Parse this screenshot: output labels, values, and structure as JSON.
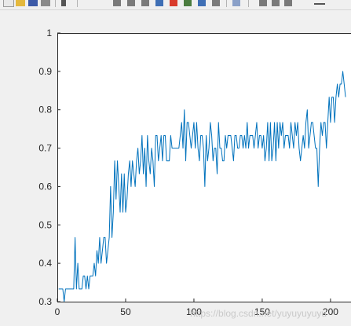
{
  "toolbar": {
    "icons": [
      "new-figure-icon",
      "open-file-icon",
      "save-icon",
      "print-icon",
      "edit-plot-icon",
      "zoom-in-icon",
      "zoom-out-icon",
      "pan-icon",
      "rotate-icon",
      "data-cursor-icon",
      "brush-icon",
      "insert-legend-icon",
      "link-plot-icon",
      "dock-icon"
    ]
  },
  "watermark": "https://blog.csdn.net/yuyuyuyuyu",
  "colors": {
    "figure_bg": "#f0f0f0",
    "axes_bg": "#ffffff",
    "line": "#0072bd",
    "axis": "#262626"
  },
  "chart_data": {
    "type": "line",
    "title": "",
    "xlabel": "",
    "ylabel": "",
    "xlim": [
      0,
      215
    ],
    "ylim": [
      0.3,
      1.0
    ],
    "xticks": [
      0,
      50,
      100,
      150,
      200
    ],
    "yticks": [
      0.3,
      0.4,
      0.5,
      0.6,
      0.7,
      0.8,
      0.9,
      1.0
    ],
    "xtick_labels": [
      "0",
      "50",
      "100",
      "150",
      "200"
    ],
    "ytick_labels": [
      "0.3",
      "0.4",
      "0.5",
      "0.6",
      "0.7",
      "0.8",
      "0.9",
      "1"
    ],
    "grid": false,
    "series": [
      {
        "values": [
          0.333,
          0.333,
          0.333,
          0.333,
          0.3,
          0.333,
          0.333,
          0.333,
          0.333,
          0.333,
          0.333,
          0.333,
          0.467,
          0.333,
          0.4,
          0.333,
          0.333,
          0.333,
          0.367,
          0.367,
          0.333,
          0.367,
          0.333,
          0.367,
          0.367,
          0.367,
          0.4,
          0.367,
          0.433,
          0.4,
          0.467,
          0.4,
          0.433,
          0.467,
          0.467,
          0.4,
          0.433,
          0.467,
          0.6,
          0.467,
          0.533,
          0.667,
          0.567,
          0.667,
          0.6,
          0.533,
          0.633,
          0.533,
          0.633,
          0.533,
          0.567,
          0.633,
          0.667,
          0.6,
          0.667,
          0.633,
          0.6,
          0.667,
          0.7,
          0.633,
          0.667,
          0.733,
          0.633,
          0.7,
          0.6,
          0.733,
          0.667,
          0.633,
          0.7,
          0.667,
          0.6,
          0.733,
          0.733,
          0.667,
          0.7,
          0.733,
          0.667,
          0.733,
          0.733,
          0.667,
          0.667,
          0.667,
          0.733,
          0.7,
          0.7,
          0.7,
          0.7,
          0.7,
          0.7,
          0.733,
          0.767,
          0.7,
          0.8,
          0.667,
          0.767,
          0.767,
          0.733,
          0.7,
          0.733,
          0.767,
          0.7,
          0.767,
          0.7,
          0.667,
          0.733,
          0.733,
          0.7,
          0.6,
          0.733,
          0.667,
          0.7,
          0.767,
          0.733,
          0.667,
          0.7,
          0.7,
          0.633,
          0.767,
          0.7,
          0.7,
          0.667,
          0.667,
          0.733,
          0.7,
          0.733,
          0.733,
          0.733,
          0.7,
          0.667,
          0.733,
          0.733,
          0.7,
          0.7,
          0.733,
          0.733,
          0.7,
          0.733,
          0.7,
          0.767,
          0.7,
          0.733,
          0.733,
          0.733,
          0.7,
          0.733,
          0.767,
          0.7,
          0.733,
          0.733,
          0.7,
          0.733,
          0.667,
          0.7,
          0.767,
          0.667,
          0.767,
          0.667,
          0.7,
          0.767,
          0.667,
          0.767,
          0.7,
          0.767,
          0.733,
          0.767,
          0.7,
          0.733,
          0.733,
          0.733,
          0.7,
          0.767,
          0.733,
          0.7,
          0.767,
          0.733,
          0.767,
          0.7,
          0.667,
          0.7,
          0.733,
          0.7,
          0.767,
          0.8,
          0.7,
          0.733,
          0.767,
          0.767,
          0.733,
          0.7,
          0.7,
          0.6,
          0.7,
          0.767,
          0.733,
          0.767,
          0.767,
          0.7,
          0.767,
          0.833,
          0.767,
          0.833,
          0.833,
          0.767,
          0.833,
          0.867,
          0.833,
          0.867,
          0.867,
          0.9,
          0.867,
          0.833
        ]
      }
    ]
  }
}
